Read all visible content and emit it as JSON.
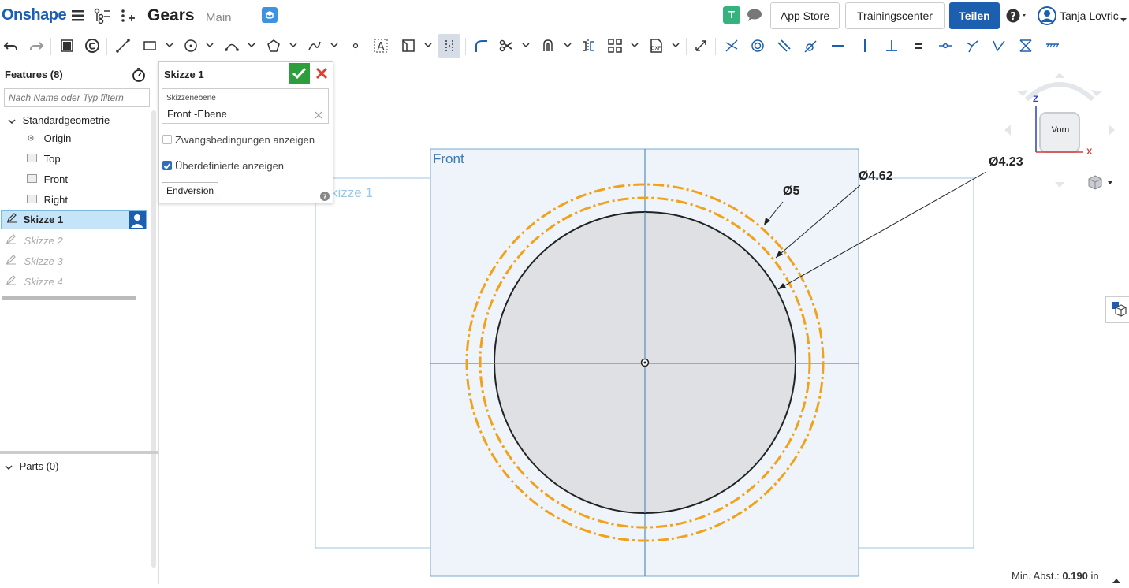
{
  "header": {
    "logo": "Onshape",
    "doc_title": "Gears",
    "branch": "Main",
    "user_badge": "T",
    "app_store": "App Store",
    "training_center": "Trainingscenter",
    "share": "Teilen",
    "user_name": "Tanja Lovric"
  },
  "sidebar": {
    "features_title": "Features (8)",
    "filter_placeholder": "Nach Name oder Typ filtern",
    "group_label": "Standardgeometrie",
    "items": [
      {
        "label": "Origin"
      },
      {
        "label": "Top"
      },
      {
        "label": "Front"
      },
      {
        "label": "Right"
      }
    ],
    "sketches": [
      {
        "label": "Skizze 1",
        "state": "selected"
      },
      {
        "label": "Skizze 2",
        "state": "suppressed"
      },
      {
        "label": "Skizze 3",
        "state": "suppressed"
      },
      {
        "label": "Skizze 4",
        "state": "suppressed"
      }
    ],
    "parts_label": "Parts (0)"
  },
  "dialog": {
    "title": "Skizze 1",
    "plane_label": "Skizzenebene",
    "plane_value": "Front -Ebene",
    "show_constraints": "Zwangsbedingungen anzeigen",
    "show_constraints_checked": false,
    "show_overdefined": "Überdefinierte anzeigen",
    "show_overdefined_checked": true,
    "final_version": "Endversion"
  },
  "canvas": {
    "plane_label": "Front",
    "sketch_label": "kizze 1",
    "dims": [
      "Ø5",
      "Ø4.62",
      "Ø4.23"
    ],
    "view_cube": {
      "face": "Vorn",
      "x_axis": "X",
      "z_axis": "Z"
    },
    "status_label": "Min. Abst.:",
    "status_value": "0.190",
    "status_unit": "in"
  },
  "colors": {
    "brand": "#1a5fb4",
    "accent_orange": "#f2a21a",
    "badge_green": "#35b37e",
    "confirm_green": "#2e9e3c",
    "cancel_red": "#d9412e"
  }
}
